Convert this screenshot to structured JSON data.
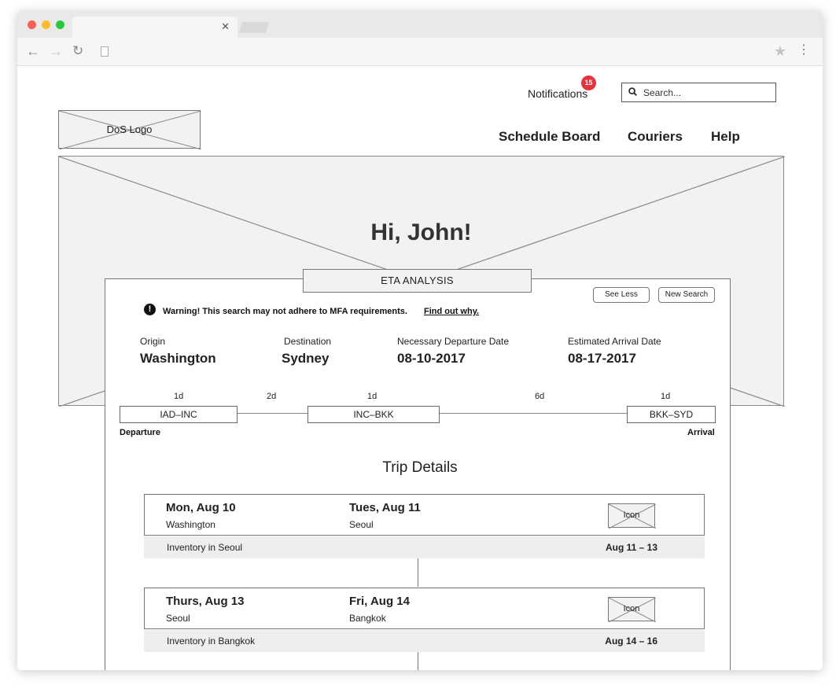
{
  "header": {
    "notifications_label": "Notifications",
    "notifications_count": "15",
    "search_placeholder": "Search..."
  },
  "logo": {
    "label": "DoS Logo"
  },
  "nav": {
    "schedule_board": "Schedule Board",
    "couriers": "Couriers",
    "help": "Help"
  },
  "hero": {
    "greeting": "Hi, John!"
  },
  "eta": {
    "title": "ETA  ANALYSIS",
    "see_less": "See Less",
    "new_search": "New Search",
    "warning_text": "Warning! This search may not adhere to MFA requirements.",
    "warning_link": "Find out why.",
    "origin_label": "Origin",
    "origin_value": "Washington",
    "destination_label": "Destination",
    "destination_value": "Sydney",
    "departure_label": "Necessary Departure Date",
    "departure_value": "08-10-2017",
    "arrival_label": "Estimated Arrival Date",
    "arrival_value": "08-17-2017"
  },
  "route": {
    "legs": [
      {
        "code": "IAD–INC",
        "duration": "1d"
      },
      {
        "code": "INC–BKK",
        "duration": "1d"
      },
      {
        "code": "BKK–SYD",
        "duration": "1d"
      }
    ],
    "layovers": [
      "2d",
      "6d"
    ],
    "start_label": "Departure",
    "end_label": "Arrival"
  },
  "trip": {
    "title": "Trip Details",
    "cards": [
      {
        "from_date": "Mon, Aug 10",
        "from_city": "Washington",
        "to_date": "Tues, Aug 11",
        "to_city": "Seoul",
        "icon_label": "Icon",
        "inventory_label": "Inventory in Seoul",
        "inventory_range": "Aug 11 – 13"
      },
      {
        "from_date": "Thurs, Aug 13",
        "from_city": "Seoul",
        "to_date": "Fri, Aug 14",
        "to_city": "Bangkok",
        "icon_label": "Icon",
        "inventory_label": "Inventory in Bangkok",
        "inventory_range": "Aug 14 – 16"
      }
    ]
  },
  "colors": {
    "badge": "#e8323b",
    "placeholder_fill": "#f2f2f2",
    "border": "#777777"
  }
}
